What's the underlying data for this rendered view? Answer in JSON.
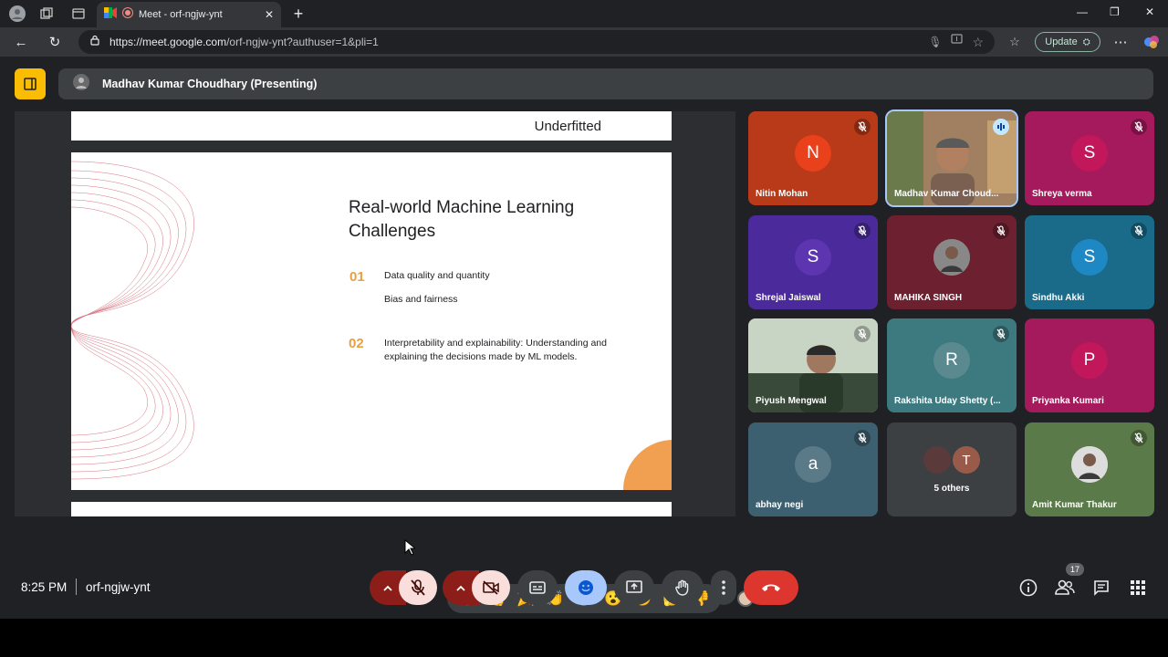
{
  "browser": {
    "tab_title": "Meet - orf-ngjw-ynt",
    "url_host": "https://meet.google.com",
    "url_path": "/orf-ngjw-ynt?authuser=1&pli=1",
    "update_label": "Update"
  },
  "presenting": {
    "label": "Madhav Kumar Choudhary (Presenting)"
  },
  "slide": {
    "header": "Underfitted",
    "title": "Real-world Machine Learning Challenges",
    "items": [
      {
        "number": "01",
        "lines": [
          "Data quality and quantity",
          "Bias and fairness"
        ]
      },
      {
        "number": "02",
        "lines": [
          "Interpretability and explainability: Understanding and explaining the decisions made by ML models."
        ]
      }
    ]
  },
  "participants": [
    {
      "name": "Nitin Mohan",
      "initial": "N",
      "bg": "#b83a18",
      "avatar_bg": "#e8411c",
      "muted": true
    },
    {
      "name": "Madhav Kumar Choud...",
      "initial": "",
      "bg": "#8a7a5a",
      "avatar_bg": "",
      "muted": false,
      "speaking": true,
      "video": true
    },
    {
      "name": "Shreya verma",
      "initial": "S",
      "bg": "#a51a5c",
      "avatar_bg": "#c2185b",
      "muted": true
    },
    {
      "name": "Shrejal Jaiswal",
      "initial": "S",
      "bg": "#4b2a9c",
      "avatar_bg": "#5e35b1",
      "muted": true
    },
    {
      "name": "MAHIKA SINGH",
      "initial": "",
      "bg": "#6d2030",
      "avatar_bg": "#888",
      "muted": true,
      "photo": true
    },
    {
      "name": "Sindhu Akki",
      "initial": "S",
      "bg": "#1a6a8a",
      "avatar_bg": "#1e88c5",
      "muted": true
    },
    {
      "name": "Piyush Mengwal",
      "initial": "",
      "bg": "#8a9a88",
      "avatar_bg": "",
      "muted": true,
      "video": true
    },
    {
      "name": "Rakshita Uday Shetty (...",
      "initial": "R",
      "bg": "#3d7a80",
      "avatar_bg": "#5a8a90",
      "muted": true
    },
    {
      "name": "Priyanka Kumari",
      "initial": "P",
      "bg": "#a51a5c",
      "avatar_bg": "#c2185b",
      "muted": false
    },
    {
      "name": "abhay negi",
      "initial": "a",
      "bg": "#3d6070",
      "avatar_bg": "#5a7a88",
      "muted": true
    },
    {
      "name": "5 others",
      "initial": "T",
      "bg": "#3c4043",
      "avatar_bg": "#9a5a4a",
      "muted": false,
      "group": true
    },
    {
      "name": "Amit Kumar Thakur",
      "initial": "",
      "bg": "#5a7a4a",
      "avatar_bg": "#ddd",
      "muted": true,
      "photo": true
    }
  ],
  "reactions": [
    "💖",
    "👍",
    "🎉",
    "👏",
    "😂",
    "😮",
    "😢",
    "🤔",
    "👎"
  ],
  "bottom": {
    "time": "8:25 PM",
    "meeting_code": "orf-ngjw-ynt",
    "people_count": "17"
  }
}
